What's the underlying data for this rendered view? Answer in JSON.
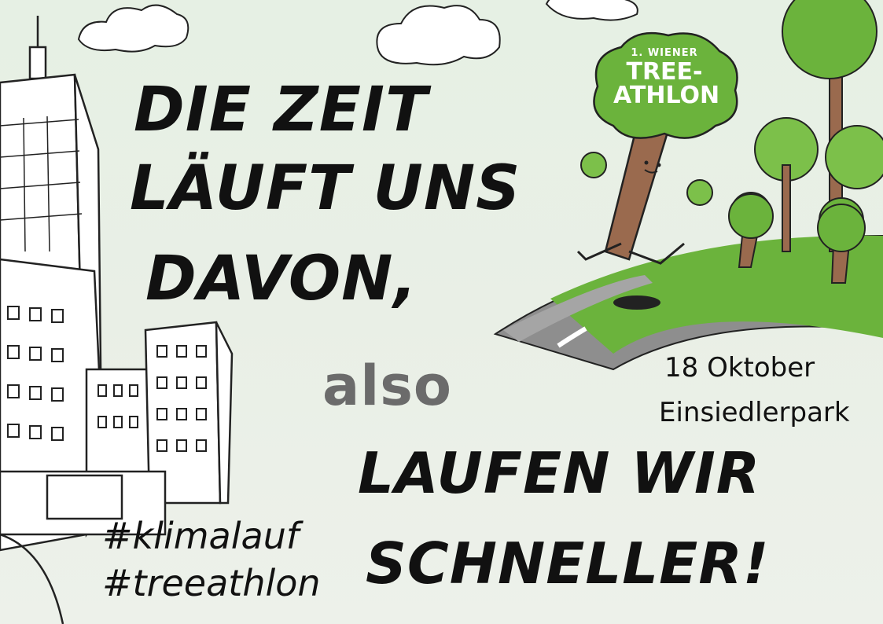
{
  "headline": {
    "line1": "DIE ZEIT",
    "line2": "LÄUFT UNS",
    "line3": "DAVON,",
    "connector": "also",
    "line4": "LAUFEN WIR",
    "line5": "SCHNELLER!"
  },
  "event": {
    "date": "18 Oktober",
    "location": "Einsiedlerpark"
  },
  "hashtags": [
    "#klimalauf",
    "#treeathlon"
  ],
  "logo": {
    "prefix": "1. WIENER",
    "line1": "TREE-",
    "line2": "ATHLON"
  },
  "colors": {
    "background": "#e8efe6",
    "headline": "#111111",
    "connector": "#6b6b6b",
    "tree_green": "#6bb33c",
    "trunk_brown": "#9a6a4e",
    "road_gray": "#8e8e8e"
  }
}
